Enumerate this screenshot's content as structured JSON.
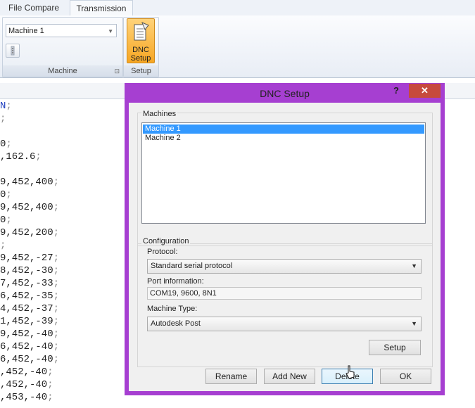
{
  "ribbon": {
    "tabs": [
      "File Compare",
      "Transmission"
    ],
    "machine_combo": "Machine 1",
    "group_machine": "Machine",
    "dnc_button": "DNC Setup",
    "group_setup": "Setup"
  },
  "code_lines": [
    {
      "text": "N",
      "semi": ";"
    },
    {
      "text": "",
      "semi": ";"
    },
    {
      "text": "",
      "semi": ""
    },
    {
      "text": "0",
      "semi": ";"
    },
    {
      "text": ",162.6",
      "semi": ";"
    },
    {
      "text": "",
      "semi": ""
    },
    {
      "text": "9,452,400",
      "semi": ";"
    },
    {
      "text": "0",
      "semi": ";"
    },
    {
      "text": "9,452,400",
      "semi": ";"
    },
    {
      "text": "0",
      "semi": ";"
    },
    {
      "text": "9,452,200",
      "semi": ";"
    },
    {
      "text": "",
      "semi": ";"
    },
    {
      "text": "9,452,-27",
      "semi": ";"
    },
    {
      "text": "8,452,-30",
      "semi": ";"
    },
    {
      "text": "7,452,-33",
      "semi": ";"
    },
    {
      "text": "6,452,-35",
      "semi": ";"
    },
    {
      "text": "4,452,-37",
      "semi": ";"
    },
    {
      "text": "1,452,-39",
      "semi": ";"
    },
    {
      "text": "9,452,-40",
      "semi": ";"
    },
    {
      "text": "6,452,-40",
      "semi": ";"
    },
    {
      "text": "6,452,-40",
      "semi": ";"
    },
    {
      "text": ",452,-40",
      "semi": ";"
    },
    {
      "text": ",452,-40",
      "semi": ";"
    },
    {
      "text": ",453,-40",
      "semi": ";"
    }
  ],
  "dialog": {
    "title": "DNC Setup",
    "help": "?",
    "close": "✕",
    "machines_group": "Machines",
    "machines": [
      "Machine 1",
      "Machine 2"
    ],
    "selected_machine": "Machine 1",
    "config_group": "Configuration",
    "protocol_label": "Protocol:",
    "protocol_value": "Standard serial protocol",
    "port_label": "Port information:",
    "port_value": "COM19, 9600, 8N1",
    "type_label": "Machine Type:",
    "type_value": "Autodesk Post",
    "setup_button": "Setup",
    "rename_button": "Rename",
    "addnew_button": "Add New",
    "delete_button": "Delete",
    "ok_button": "OK"
  },
  "colors": {
    "dialog_frame": "#a63fd1",
    "selection": "#3399ff",
    "close": "#c74a3d",
    "dnc_button": "#f6a623"
  }
}
